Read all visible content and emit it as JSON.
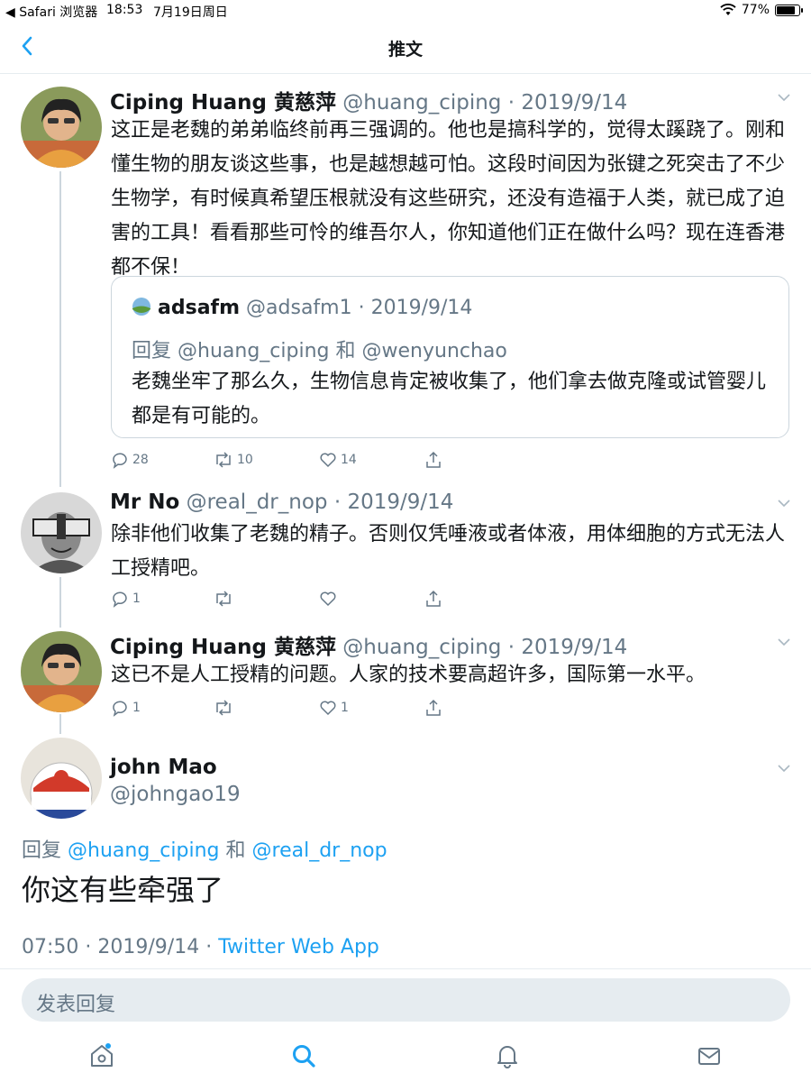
{
  "status": {
    "carrier": "◀ Safari 浏览器",
    "time": "18:53",
    "date": "7月19日周日",
    "battery": "77%",
    "battery_level": 0.77
  },
  "nav": {
    "title": "推文"
  },
  "tweets": [
    {
      "name": "Ciping Huang 黄慈萍",
      "handle": "@huang_ciping",
      "sep": "·",
      "date": "2019/9/14",
      "text": "这正是老魏的弟弟临终前再三强调的。他也是搞科学的，觉得太蹊跷了。刚和懂生物的朋友谈这些事，也是越想越可怕。这段时间因为张键之死突击了不少生物学，有时候真希望压根就没有这些研究，还没有造福于人类，就已成了迫害的工具！看看那些可怜的维吾尔人，你知道他们正在做什么吗？现在连香港都不保！",
      "quote": {
        "name": "adsafm",
        "handle": "@adsafm1",
        "sep": "·",
        "date": "2019/9/14",
        "reply_prefix": "回复",
        "reply_to_1": "@huang_ciping",
        "reply_and": "和",
        "reply_to_2": "@wenyunchao",
        "text": "老魏坐牢了那么久，生物信息肯定被收集了，他们拿去做克隆或试管婴儿都是有可能的。"
      },
      "replies": "28",
      "retweets": "10",
      "likes": "14"
    },
    {
      "name": "Mr No",
      "handle": "@real_dr_nop",
      "sep": "·",
      "date": "2019/9/14",
      "text": "除非他们收集了老魏的精子。否则仅凭唾液或者体液，用体细胞的方式无法人工授精吧。",
      "replies": "1",
      "retweets": "",
      "likes": ""
    },
    {
      "name": "Ciping Huang 黄慈萍",
      "handle": "@huang_ciping",
      "sep": "·",
      "date": "2019/9/14",
      "text": "这已不是人工授精的问题。人家的技术要高超许多，国际第一水平。",
      "replies": "1",
      "retweets": "",
      "likes": "1"
    }
  ],
  "main": {
    "name": "john Mao",
    "handle": "@johngao19",
    "reply_prefix": "回复",
    "reply_to_1": "@huang_ciping",
    "reply_and": "和",
    "reply_to_2": "@real_dr_nop",
    "text": "你这有些牵强了",
    "time": "07:50",
    "sep": "·",
    "date": "2019/9/14",
    "source": "Twitter Web App"
  },
  "compose": {
    "placeholder": "发表回复"
  },
  "colors": {
    "accent": "#1da1f2",
    "muted": "#657786",
    "border": "#ccd6dd"
  }
}
